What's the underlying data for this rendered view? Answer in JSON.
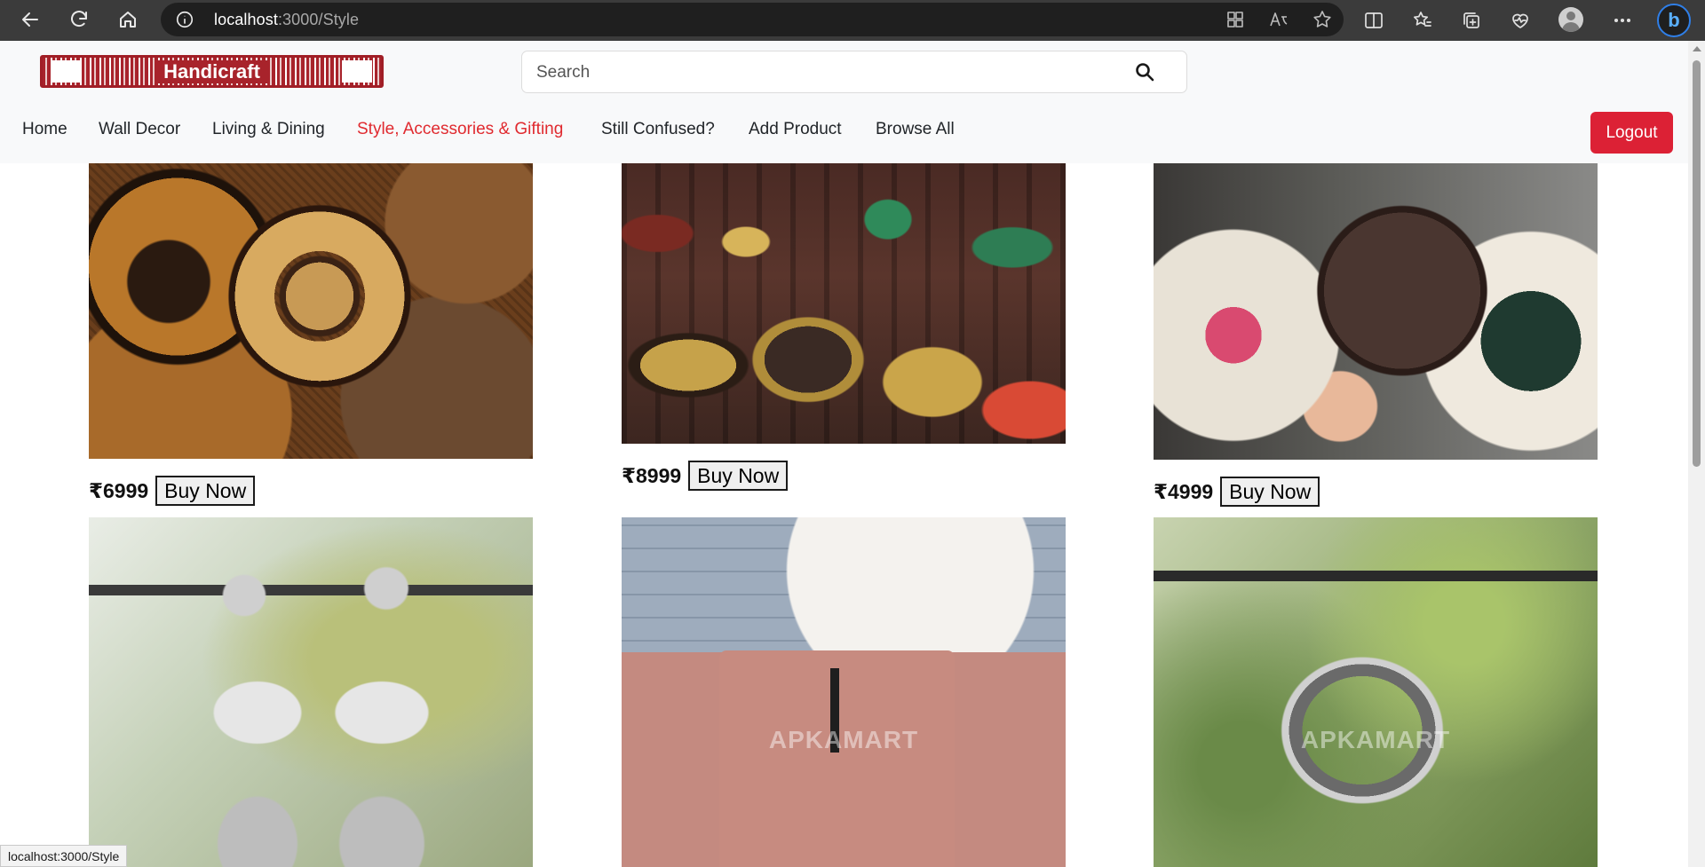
{
  "browser": {
    "url_host": "localhost",
    "url_path": ":3000/Style",
    "icons": [
      "back-icon",
      "reload-icon",
      "home-icon",
      "info-icon",
      "apps-icon",
      "read-aloud-icon",
      "favorite-star-icon",
      "split-screen-icon",
      "favorites-icon",
      "collections-icon",
      "browser-essentials-icon",
      "profile-icon",
      "more-icon",
      "bing-copilot-icon"
    ]
  },
  "header": {
    "logo_text": "Handicraft",
    "search_placeholder": "Search",
    "menu": [
      {
        "label": "Home",
        "active": false
      },
      {
        "label": "Wall Decor",
        "active": false
      },
      {
        "label": "Living & Dining",
        "active": false
      },
      {
        "label": "Style, Accessories & Gifting",
        "active": true
      },
      {
        "label": "Still Confused?",
        "active": false
      },
      {
        "label": "Add Product",
        "active": false
      },
      {
        "label": "Browse All",
        "active": false
      }
    ],
    "logout_label": "Logout"
  },
  "products": [
    {
      "image": "woven-baskets",
      "price": "₹6999",
      "buy_label": "Buy Now"
    },
    {
      "image": "clay-pottery",
      "price": "₹8999",
      "buy_label": "Buy Now"
    },
    {
      "image": "rattan-round-bags",
      "price": "₹4999",
      "buy_label": "Buy Now"
    },
    {
      "image": "silver-jhumka-earrings",
      "watermark": ""
    },
    {
      "image": "pink-leather-handbag",
      "watermark": "APKAMART"
    },
    {
      "image": "silver-bangle",
      "watermark": "APKAMART"
    }
  ],
  "status_bar": {
    "text": "localhost:3000/Style"
  },
  "colors": {
    "brand_red": "#a8232b",
    "active_link": "#e02a2f",
    "logout_bg": "#dc2135",
    "header_bg": "#f8f9fa",
    "chrome_bg": "#3b3b3b"
  }
}
